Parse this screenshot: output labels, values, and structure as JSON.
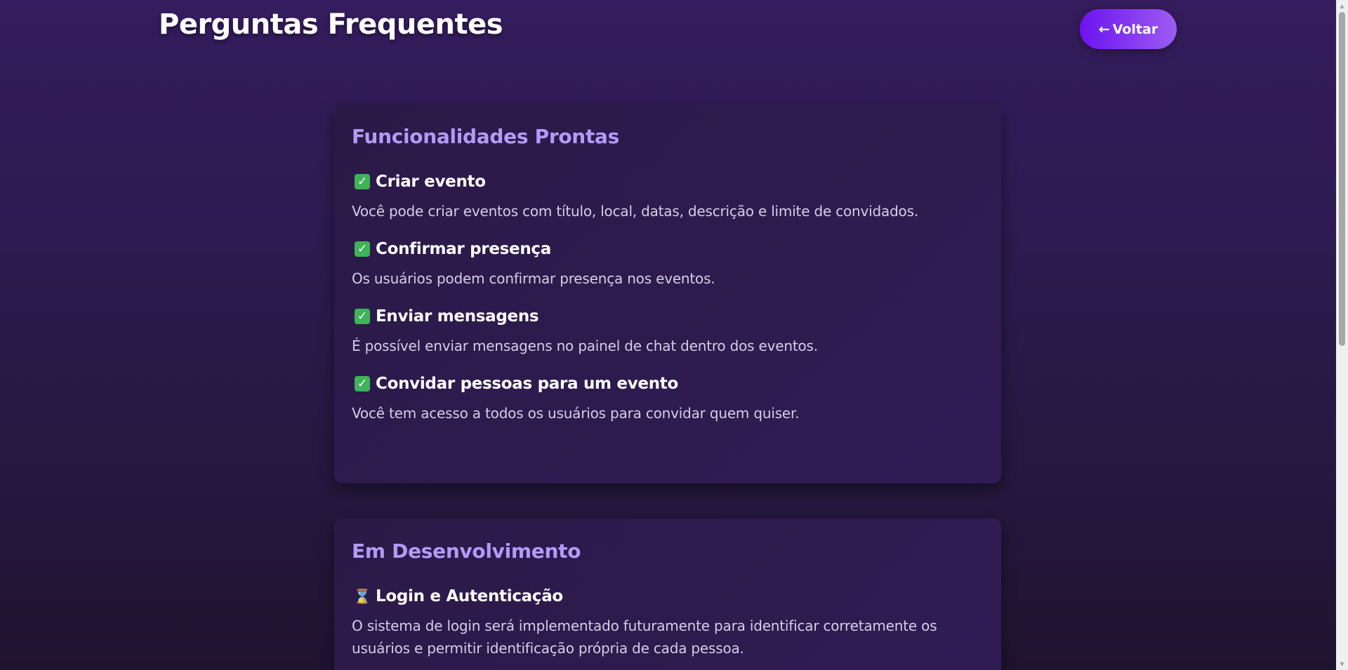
{
  "header": {
    "title": "Perguntas Frequentes",
    "back_arrow": "←",
    "back_label": "Voltar"
  },
  "sections": [
    {
      "title": "Funcionalidades Prontas",
      "status_icon": "check-mark-icon",
      "items": [
        {
          "question": "Criar evento",
          "answer": "Você pode criar eventos com título, local, datas, descrição e limite de convidados."
        },
        {
          "question": "Confirmar presença",
          "answer": "Os usuários podem confirmar presença nos eventos."
        },
        {
          "question": "Enviar mensagens",
          "answer": "É possível enviar mensagens no painel de chat dentro dos eventos."
        },
        {
          "question": "Convidar pessoas para um evento",
          "answer": "Você tem acesso a todos os usuários para convidar quem quiser."
        }
      ]
    },
    {
      "title": "Em Desenvolvimento",
      "status_icon": "hourglass-icon",
      "items": [
        {
          "question": "Login e Autenticação",
          "answer": "O sistema de login será implementado futuramente para identificar corretamente os usuários e permitir identificação própria de cada pessoa."
        }
      ]
    }
  ],
  "colors": {
    "background_top": "#351c5e",
    "background_bottom": "#1f1430",
    "section_title": "#b49af7",
    "button_start": "#6d13f0",
    "button_end": "#9c5cf2",
    "check_icon": "#3fb35a"
  }
}
